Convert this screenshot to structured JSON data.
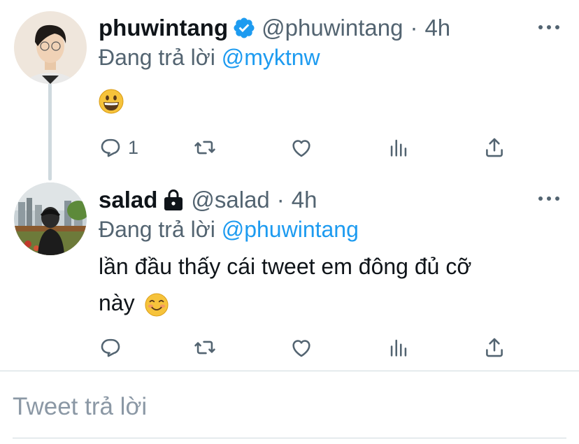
{
  "tweets": [
    {
      "display_name": "phuwintang",
      "verified": true,
      "handle": "@phuwintang",
      "separator": "·",
      "time": "4h",
      "reply_prefix": "Đang trả lời ",
      "reply_to": "@myktnw",
      "text": "",
      "emoji_icon": "grinning-face-icon",
      "actions": {
        "reply_count": "1",
        "retweet_count": "",
        "like_count": ""
      }
    },
    {
      "display_name": "salad",
      "verified": false,
      "locked": true,
      "handle": "@salad",
      "separator": "·",
      "time": "4h",
      "reply_prefix": "Đang trả lời ",
      "reply_to": "@phuwintang",
      "text_line1": "lần đầu thấy cái tweet em đông đủ cỡ",
      "text_line2": "này",
      "emoji_icon": "smiling-face-icon",
      "actions": {
        "reply_count": "",
        "retweet_count": "",
        "like_count": ""
      }
    }
  ],
  "reply_box": {
    "placeholder": "Tweet trả lời"
  },
  "colors": {
    "accent": "#1d9bf0",
    "muted": "#536471",
    "text": "#0f1419",
    "divider": "#cfd9de"
  }
}
